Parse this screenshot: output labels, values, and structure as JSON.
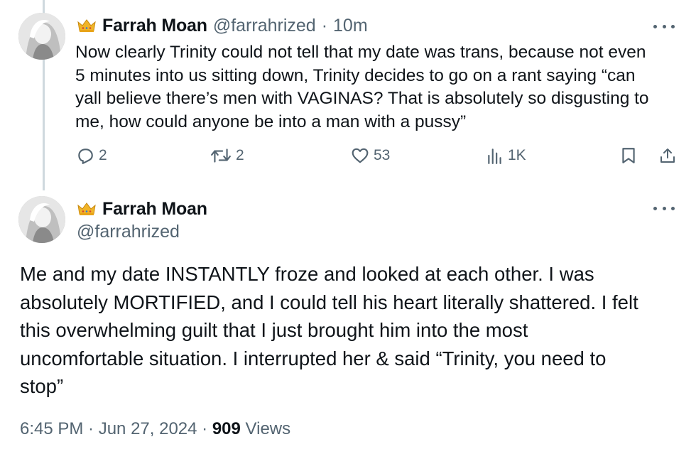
{
  "colors": {
    "text_primary": "#0f1419",
    "text_secondary": "#536471",
    "thread_line": "#cfd9de",
    "crown_gold": "#f0b429",
    "background": "#ffffff"
  },
  "reply_tweet": {
    "display_name": "Farrah Moan",
    "handle": "@farrahrized",
    "separator": "·",
    "time": "10m",
    "badge_icon": "crown-icon",
    "text": "Now clearly Trinity could not tell that my date was trans, because not even\n5 minutes into us sitting down, Trinity decides to go on a rant saying “can\nyall believe there’s men with VAGINAS? That is absolutely so disgusting to\nme, how could anyone be into a man with a pussy”",
    "actions": {
      "replies": "2",
      "retweets": "2",
      "likes": "53",
      "views": "1K"
    }
  },
  "main_tweet": {
    "display_name": "Farrah Moan",
    "handle": "@farrahrized",
    "badge_icon": "crown-icon",
    "text": "Me and my date INSTANTLY froze and looked at each other. I was\nabsolutely MORTIFIED, and I could tell his heart literally shattered. I felt\nthis overwhelming guilt that I just brought him into the most\nuncomfortable situation. I interrupted her & said “Trinity, you need to\nstop”",
    "timestamp": "6:45 PM · Jun 27, 2024 · ",
    "views_count": "909",
    "views_label": " Views"
  }
}
